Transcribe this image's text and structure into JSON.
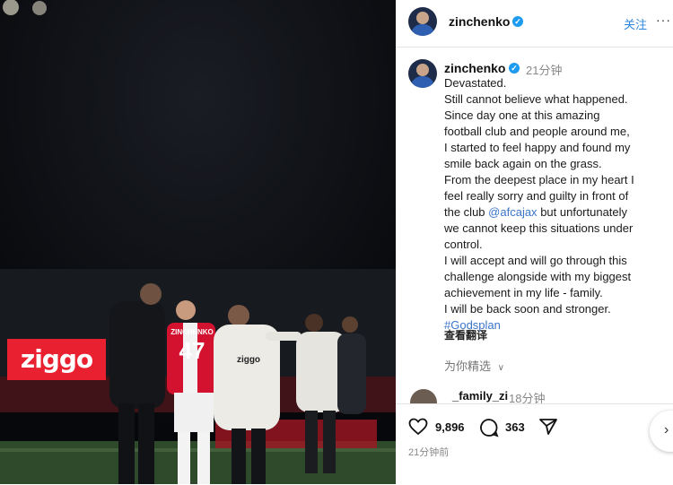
{
  "photo": {
    "banner_text": "ziggo",
    "shirt_name": "ZINCHENKO",
    "shirt_number": "47",
    "jacket_logo": "ziggo"
  },
  "header": {
    "username": "zinchenko",
    "follow_label": "关注",
    "more_icon": "more-dots-icon"
  },
  "post": {
    "username": "zinchenko",
    "time": "21分钟",
    "caption_lines": [
      "Devastated.",
      "Still cannot believe what happened.",
      "Since day one at this amazing",
      "football club and people around me,",
      "I started to feel happy and found my",
      "smile back again on the grass.",
      "From the deepest place in my heart I",
      "feel really sorry and guilty in front of",
      "the club",
      "@afcajax",
      "but unfortunately",
      "we cannot keep this situations under",
      "control.",
      "I will accept and will go through this",
      "challenge alongside with my biggest",
      "achievement in my life - family.",
      "I will be back soon and stronger.",
      "#Godsplan"
    ],
    "see_translation": "查看翻译",
    "similar_label": "为你精选"
  },
  "comment": {
    "username": "_family_zi",
    "time": "18分钟"
  },
  "actions": {
    "likes": "9,896",
    "comments": "363",
    "time_ago": "21分钟前"
  },
  "colors": {
    "verified": "#1d9bf0",
    "follow": "#2c86dd",
    "link": "#3a74c8",
    "ajax_red": "#d2122e"
  }
}
